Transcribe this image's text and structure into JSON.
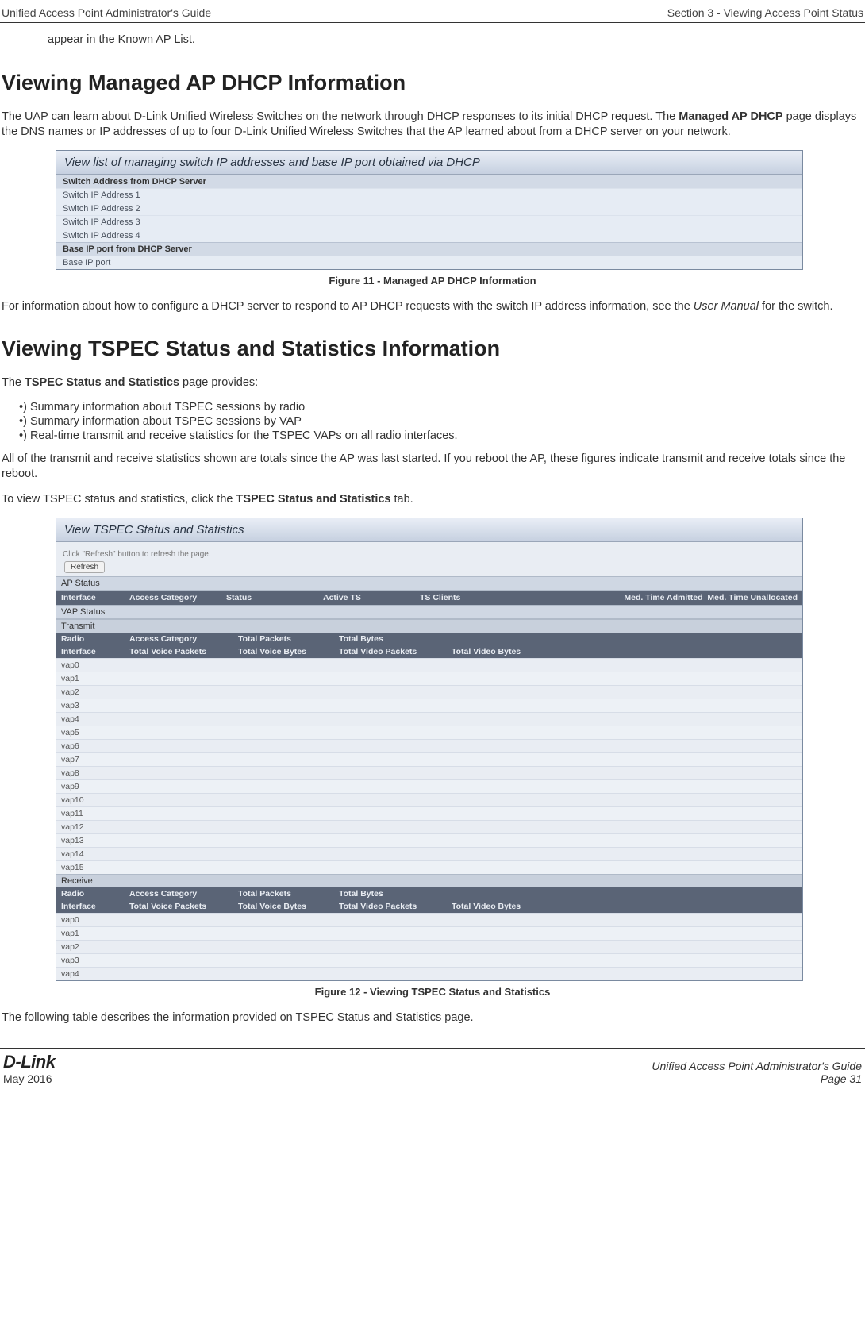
{
  "header": {
    "left": "Unified Access Point Administrator's Guide",
    "right": "Section 3 - Viewing Access Point Status"
  },
  "lead": "appear in the Known AP List.",
  "h1a": "Viewing Managed AP DHCP Information",
  "p1a": "The UAP can learn about D-Link Unified Wireless Switches on the network through DHCP responses to its initial DHCP request. The ",
  "p1b_bold": "Managed AP DHCP",
  "p1c": " page displays the DNS names or IP addresses of up to four D-Link Unified Wireless Switches that the AP learned about from a DHCP server on your network.",
  "fig1": {
    "title": "View list of managing switch IP addresses and base IP port obtained via DHCP",
    "head1": "Switch Address from DHCP Server",
    "r1": "Switch IP Address 1",
    "r2": "Switch IP Address 2",
    "r3": "Switch IP Address 3",
    "r4": "Switch IP Address 4",
    "head2": "Base IP port from DHCP Server",
    "r5": "Base IP port",
    "caption": "Figure 11 - Managed AP DHCP Information"
  },
  "p2a": "For information about how to configure a DHCP server to respond to AP DHCP requests with the switch IP address information, see the ",
  "p2_italic": "User Manual",
  "p2b": " for the switch.",
  "h1b": "Viewing TSPEC Status and Statistics Information",
  "p3a": "The ",
  "p3_bold": "TSPEC Status and Statistics",
  "p3b": " page provides:",
  "bullets": {
    "b1": "Summary information about TSPEC sessions by radio",
    "b2": "Summary information about TSPEC sessions by VAP",
    "b3": "Real-time transmit and receive statistics for the TSPEC VAPs on all radio interfaces."
  },
  "p4": "All of the transmit and receive statistics shown are totals since the AP was last started. If you reboot the AP, these figures indicate transmit and receive totals since the reboot.",
  "p5a": "To view TSPEC status and statistics, click the ",
  "p5_bold": "TSPEC Status and Statistics",
  "p5b": " tab.",
  "fig2": {
    "title": "View TSPEC Status and Statistics",
    "note": "Click \"Refresh\" button to refresh the page.",
    "btn": "Refresh",
    "ap_status": "AP Status",
    "hdr_if": "Interface",
    "hdr_ac": "Access Category",
    "hdr_status": "Status",
    "hdr_ats": "Active TS",
    "hdr_tsc": "TS Clients",
    "hdr_mta": "Med. Time Admitted",
    "hdr_mtu": "Med. Time Unallocated",
    "vap_status": "VAP Status",
    "transmit": "Transmit",
    "hdr_radio": "Radio",
    "hdr_int": "Interface",
    "hdr_tp": "Total Packets",
    "hdr_tb": "Total Bytes",
    "hdr_tvp": "Total Voice Packets",
    "hdr_tvb": "Total Voice Bytes",
    "hdr_tvidp": "Total Video Packets",
    "hdr_tvidb": "Total Video Bytes",
    "receive": "Receive",
    "vaps_t": [
      "vap0",
      "vap1",
      "vap2",
      "vap3",
      "vap4",
      "vap5",
      "vap6",
      "vap7",
      "vap8",
      "vap9",
      "vap10",
      "vap11",
      "vap12",
      "vap13",
      "vap14",
      "vap15"
    ],
    "vaps_r": [
      "vap0",
      "vap1",
      "vap2",
      "vap3",
      "vap4"
    ],
    "caption": "Figure 12 - Viewing TSPEC Status and Statistics"
  },
  "p6": "The following table describes the information provided on TSPEC Status and Statistics page.",
  "footer": {
    "logo": "D-Link",
    "date": "May 2016",
    "r1": "Unified Access Point Administrator's Guide",
    "r2": "Page 31"
  }
}
